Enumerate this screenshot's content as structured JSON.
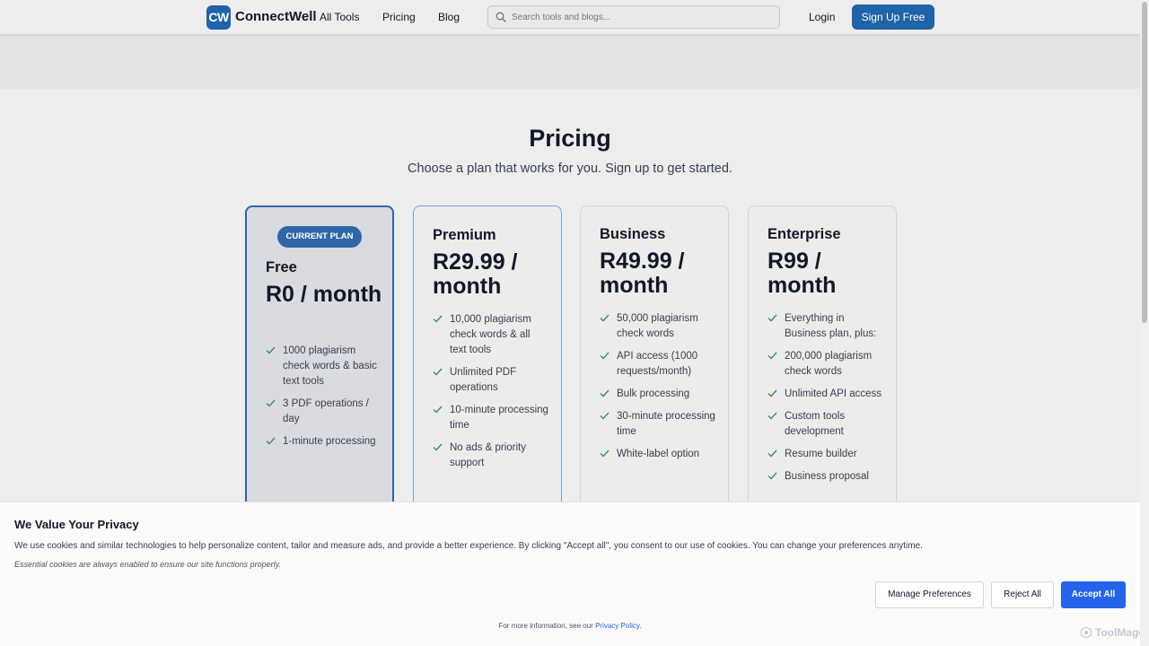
{
  "header": {
    "logo_mark": "CW",
    "brand": "ConnectWell",
    "nav": [
      "All Tools",
      "Pricing",
      "Blog"
    ],
    "search_placeholder": "Search tools and blogs...",
    "login": "Login",
    "signup": "Sign Up Free"
  },
  "page": {
    "title": "Pricing",
    "subtitle": "Choose a plan that works for you. Sign up to get started."
  },
  "plans": [
    {
      "badge": "CURRENT PLAN",
      "name": "Free",
      "price": "R0 / month",
      "features": [
        "1000 plagiarism check words & basic text tools",
        "3 PDF operations / day",
        "1-minute processing"
      ]
    },
    {
      "name": "Premium",
      "price": "R29.99 / month",
      "features": [
        "10,000 plagiarism check words & all text tools",
        "Unlimited PDF operations",
        "10-minute processing time",
        "No ads & priority support"
      ]
    },
    {
      "name": "Business",
      "price": "R49.99 / month",
      "features": [
        "50,000 plagiarism check words",
        "API access (1000 requests/month)",
        "Bulk processing",
        "30-minute processing time",
        "White-label option"
      ]
    },
    {
      "name": "Enterprise",
      "price": "R99 / month",
      "features": [
        "Everything in Business plan, plus:",
        "200,000 plagiarism check words",
        "Unlimited API access",
        "Custom tools development",
        "Resume builder",
        "Business proposal"
      ]
    }
  ],
  "cookie": {
    "title": "We Value Your Privacy",
    "description": "We use cookies and similar technologies to help personalize content, tailor and measure ads, and provide a better experience. By clicking \"Accept all\", you consent to our use of cookies. You can change your preferences anytime.",
    "essential": "Essential cookies are always enabled to ensure our site functions properly.",
    "manage": "Manage Preferences",
    "reject": "Reject All",
    "accept": "Accept All",
    "more_info": "For more information, see our",
    "privacy_link": "Privacy Policy",
    "period": "."
  },
  "watermark": "ToolMage",
  "colors": {
    "brand": "#1f63a8",
    "accept": "#2563eb",
    "check": "#3f8f5c"
  },
  "icons": [
    "search-icon",
    "check-icon",
    "watermark-icon"
  ]
}
